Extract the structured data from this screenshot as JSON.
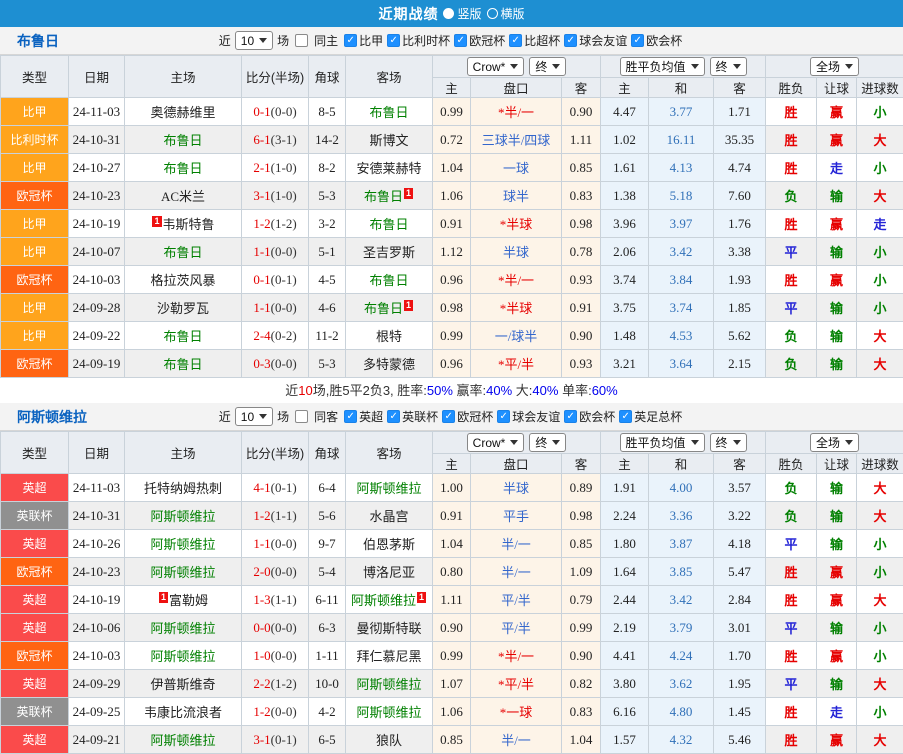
{
  "title_bar": {
    "title": "近期战绩",
    "radios": [
      {
        "label": "竖版",
        "selected": true
      },
      {
        "label": "横版",
        "selected": false
      }
    ]
  },
  "columns": {
    "main": [
      "类型",
      "日期",
      "主场",
      "比分(半场)",
      "角球",
      "客场"
    ],
    "sub": [
      "主",
      "盘口",
      "客",
      "主",
      "和",
      "客",
      "胜负",
      "让球",
      "进球数"
    ],
    "selects": [
      "Crow*",
      "终",
      "胜平负均值",
      "终",
      "全场"
    ]
  },
  "colors": {
    "red": "#e60000",
    "green": "#008000",
    "blue": "#2323d6",
    "summary_blue": "#0000ee",
    "league_orange": "#ffa41c",
    "league_deep_orange": "#ff6412",
    "league_red": "#fa4b4b",
    "league_gray": "#909090"
  },
  "teams": [
    {
      "name": "布鲁日",
      "filter": {
        "near_label": "近",
        "games": "10",
        "games_suffix": "场",
        "same_label": "同主",
        "same_checked": false,
        "leagues": [
          "比甲",
          "比利时杯",
          "欧冠杯",
          "比超杯",
          "球会友谊",
          "欧会杯"
        ]
      },
      "rows": [
        {
          "league": "比甲",
          "league_bg": "#ffa41c",
          "date": "24-11-03",
          "home": "奥德赫维里",
          "home_focus": false,
          "home_badge": "",
          "score": "0-1",
          "half": "(0-0)",
          "corners": "8-5",
          "away": "布鲁日",
          "away_focus": true,
          "away_badge": "",
          "ah_home": "0.99",
          "handicap": "*半/一",
          "handicap_red": true,
          "ah_away": "0.90",
          "eu_home": "4.47",
          "eu_draw": "3.77",
          "eu_away": "1.71",
          "result": "胜",
          "result_c": "r",
          "let": "赢",
          "let_c": "r",
          "goal": "小",
          "goal_c": "g"
        },
        {
          "league": "比利时杯",
          "league_bg": "#ffa41c",
          "date": "24-10-31",
          "home": "布鲁日",
          "home_focus": true,
          "home_badge": "",
          "score": "6-1",
          "half": "(3-1)",
          "corners": "14-2",
          "away": "斯博文",
          "away_focus": false,
          "away_badge": "",
          "ah_home": "0.72",
          "handicap": "三球半/四球",
          "handicap_red": false,
          "ah_away": "1.11",
          "eu_home": "1.02",
          "eu_draw": "16.11",
          "eu_away": "35.35",
          "result": "胜",
          "result_c": "r",
          "let": "赢",
          "let_c": "r",
          "goal": "大",
          "goal_c": "r"
        },
        {
          "league": "比甲",
          "league_bg": "#ffa41c",
          "date": "24-10-27",
          "home": "布鲁日",
          "home_focus": true,
          "home_badge": "",
          "score": "2-1",
          "half": "(1-0)",
          "corners": "8-2",
          "away": "安德莱赫特",
          "away_focus": false,
          "away_badge": "",
          "ah_home": "1.04",
          "handicap": "一球",
          "handicap_red": false,
          "ah_away": "0.85",
          "eu_home": "1.61",
          "eu_draw": "4.13",
          "eu_away": "4.74",
          "result": "胜",
          "result_c": "r",
          "let": "走",
          "let_c": "b",
          "goal": "小",
          "goal_c": "g"
        },
        {
          "league": "欧冠杯",
          "league_bg": "#ff6412",
          "date": "24-10-23",
          "home": "AC米兰",
          "home_focus": false,
          "home_badge": "",
          "score": "3-1",
          "half": "(1-0)",
          "corners": "5-3",
          "away": "布鲁日",
          "away_focus": true,
          "away_badge": "right",
          "ah_home": "1.06",
          "handicap": "球半",
          "handicap_red": false,
          "ah_away": "0.83",
          "eu_home": "1.38",
          "eu_draw": "5.18",
          "eu_away": "7.60",
          "result": "负",
          "result_c": "g",
          "let": "输",
          "let_c": "g",
          "goal": "大",
          "goal_c": "r"
        },
        {
          "league": "比甲",
          "league_bg": "#ffa41c",
          "date": "24-10-19",
          "home": "韦斯特鲁",
          "home_focus": false,
          "home_badge": "left",
          "score": "1-2",
          "half": "(1-2)",
          "corners": "3-2",
          "away": "布鲁日",
          "away_focus": true,
          "away_badge": "",
          "ah_home": "0.91",
          "handicap": "*半球",
          "handicap_red": true,
          "ah_away": "0.98",
          "eu_home": "3.96",
          "eu_draw": "3.97",
          "eu_away": "1.76",
          "result": "胜",
          "result_c": "r",
          "let": "赢",
          "let_c": "r",
          "goal": "走",
          "goal_c": "b"
        },
        {
          "league": "比甲",
          "league_bg": "#ffa41c",
          "date": "24-10-07",
          "home": "布鲁日",
          "home_focus": true,
          "home_badge": "",
          "score": "1-1",
          "half": "(0-0)",
          "corners": "5-1",
          "away": "圣吉罗斯",
          "away_focus": false,
          "away_badge": "",
          "ah_home": "1.12",
          "handicap": "半球",
          "handicap_red": false,
          "ah_away": "0.78",
          "eu_home": "2.06",
          "eu_draw": "3.42",
          "eu_away": "3.38",
          "result": "平",
          "result_c": "b",
          "let": "输",
          "let_c": "g",
          "goal": "小",
          "goal_c": "g"
        },
        {
          "league": "欧冠杯",
          "league_bg": "#ff6412",
          "date": "24-10-03",
          "home": "格拉茨风暴",
          "home_focus": false,
          "home_badge": "",
          "score": "0-1",
          "half": "(0-1)",
          "corners": "4-5",
          "away": "布鲁日",
          "away_focus": true,
          "away_badge": "",
          "ah_home": "0.96",
          "handicap": "*半/一",
          "handicap_red": true,
          "ah_away": "0.93",
          "eu_home": "3.74",
          "eu_draw": "3.84",
          "eu_away": "1.93",
          "result": "胜",
          "result_c": "r",
          "let": "赢",
          "let_c": "r",
          "goal": "小",
          "goal_c": "g"
        },
        {
          "league": "比甲",
          "league_bg": "#ffa41c",
          "date": "24-09-28",
          "home": "沙勒罗瓦",
          "home_focus": false,
          "home_badge": "",
          "score": "1-1",
          "half": "(0-0)",
          "corners": "4-6",
          "away": "布鲁日",
          "away_focus": true,
          "away_badge": "right",
          "ah_home": "0.98",
          "handicap": "*半球",
          "handicap_red": true,
          "ah_away": "0.91",
          "eu_home": "3.75",
          "eu_draw": "3.74",
          "eu_away": "1.85",
          "result": "平",
          "result_c": "b",
          "let": "输",
          "let_c": "g",
          "goal": "小",
          "goal_c": "g"
        },
        {
          "league": "比甲",
          "league_bg": "#ffa41c",
          "date": "24-09-22",
          "home": "布鲁日",
          "home_focus": true,
          "home_badge": "",
          "score": "2-4",
          "half": "(0-2)",
          "corners": "11-2",
          "away": "根特",
          "away_focus": false,
          "away_badge": "",
          "ah_home": "0.99",
          "handicap": "一/球半",
          "handicap_red": false,
          "ah_away": "0.90",
          "eu_home": "1.48",
          "eu_draw": "4.53",
          "eu_away": "5.62",
          "result": "负",
          "result_c": "g",
          "let": "输",
          "let_c": "g",
          "goal": "大",
          "goal_c": "r"
        },
        {
          "league": "欧冠杯",
          "league_bg": "#ff6412",
          "date": "24-09-19",
          "home": "布鲁日",
          "home_focus": true,
          "home_badge": "",
          "score": "0-3",
          "half": "(0-0)",
          "corners": "5-3",
          "away": "多特蒙德",
          "away_focus": false,
          "away_badge": "",
          "ah_home": "0.96",
          "handicap": "*平/半",
          "handicap_red": true,
          "ah_away": "0.93",
          "eu_home": "3.21",
          "eu_draw": "3.64",
          "eu_away": "2.15",
          "result": "负",
          "result_c": "g",
          "let": "输",
          "let_c": "g",
          "goal": "大",
          "goal_c": "r"
        }
      ],
      "summary": [
        {
          "t": "近",
          "c": "d"
        },
        {
          "t": "10",
          "c": "r"
        },
        {
          "t": "场,胜5平2负3, 胜率:",
          "c": "d"
        },
        {
          "t": "50%",
          "c": "u"
        },
        {
          "t": " 赢率:",
          "c": "d"
        },
        {
          "t": "40%",
          "c": "u"
        },
        {
          "t": " 大:",
          "c": "d"
        },
        {
          "t": "40%",
          "c": "u"
        },
        {
          "t": " 单率:",
          "c": "d"
        },
        {
          "t": "60%",
          "c": "u"
        }
      ]
    },
    {
      "name": "阿斯顿维拉",
      "filter": {
        "near_label": "近",
        "games": "10",
        "games_suffix": "场",
        "same_label": "同客",
        "same_checked": false,
        "leagues": [
          "英超",
          "英联杯",
          "欧冠杯",
          "球会友谊",
          "欧会杯",
          "英足总杯"
        ]
      },
      "rows": [
        {
          "league": "英超",
          "league_bg": "#fa4b4b",
          "date": "24-11-03",
          "home": "托特纳姆热刺",
          "home_focus": false,
          "home_badge": "",
          "score": "4-1",
          "half": "(0-1)",
          "corners": "6-4",
          "away": "阿斯顿维拉",
          "away_focus": true,
          "away_badge": "",
          "ah_home": "1.00",
          "handicap": "半球",
          "handicap_red": false,
          "ah_away": "0.89",
          "eu_home": "1.91",
          "eu_draw": "4.00",
          "eu_away": "3.57",
          "result": "负",
          "result_c": "g",
          "let": "输",
          "let_c": "g",
          "goal": "大",
          "goal_c": "r"
        },
        {
          "league": "英联杯",
          "league_bg": "#909090",
          "date": "24-10-31",
          "home": "阿斯顿维拉",
          "home_focus": true,
          "home_badge": "",
          "score": "1-2",
          "half": "(1-1)",
          "corners": "5-6",
          "away": "水晶宫",
          "away_focus": false,
          "away_badge": "",
          "ah_home": "0.91",
          "handicap": "平手",
          "handicap_red": false,
          "ah_away": "0.98",
          "eu_home": "2.24",
          "eu_draw": "3.36",
          "eu_away": "3.22",
          "result": "负",
          "result_c": "g",
          "let": "输",
          "let_c": "g",
          "goal": "大",
          "goal_c": "r"
        },
        {
          "league": "英超",
          "league_bg": "#fa4b4b",
          "date": "24-10-26",
          "home": "阿斯顿维拉",
          "home_focus": true,
          "home_badge": "",
          "score": "1-1",
          "half": "(0-0)",
          "corners": "9-7",
          "away": "伯恩茅斯",
          "away_focus": false,
          "away_badge": "",
          "ah_home": "1.04",
          "handicap": "半/一",
          "handicap_red": false,
          "ah_away": "0.85",
          "eu_home": "1.80",
          "eu_draw": "3.87",
          "eu_away": "4.18",
          "result": "平",
          "result_c": "b",
          "let": "输",
          "let_c": "g",
          "goal": "小",
          "goal_c": "g"
        },
        {
          "league": "欧冠杯",
          "league_bg": "#ff6412",
          "date": "24-10-23",
          "home": "阿斯顿维拉",
          "home_focus": true,
          "home_badge": "",
          "score": "2-0",
          "half": "(0-0)",
          "corners": "5-4",
          "away": "博洛尼亚",
          "away_focus": false,
          "away_badge": "",
          "ah_home": "0.80",
          "handicap": "半/一",
          "handicap_red": false,
          "ah_away": "1.09",
          "eu_home": "1.64",
          "eu_draw": "3.85",
          "eu_away": "5.47",
          "result": "胜",
          "result_c": "r",
          "let": "赢",
          "let_c": "r",
          "goal": "小",
          "goal_c": "g"
        },
        {
          "league": "英超",
          "league_bg": "#fa4b4b",
          "date": "24-10-19",
          "home": "富勒姆",
          "home_focus": false,
          "home_badge": "left",
          "score": "1-3",
          "half": "(1-1)",
          "corners": "6-11",
          "away": "阿斯顿维拉",
          "away_focus": true,
          "away_badge": "right",
          "ah_home": "1.11",
          "handicap": "平/半",
          "handicap_red": false,
          "ah_away": "0.79",
          "eu_home": "2.44",
          "eu_draw": "3.42",
          "eu_away": "2.84",
          "result": "胜",
          "result_c": "r",
          "let": "赢",
          "let_c": "r",
          "goal": "大",
          "goal_c": "r"
        },
        {
          "league": "英超",
          "league_bg": "#fa4b4b",
          "date": "24-10-06",
          "home": "阿斯顿维拉",
          "home_focus": true,
          "home_badge": "",
          "score": "0-0",
          "half": "(0-0)",
          "corners": "6-3",
          "away": "曼彻斯特联",
          "away_focus": false,
          "away_badge": "",
          "ah_home": "0.90",
          "handicap": "平/半",
          "handicap_red": false,
          "ah_away": "0.99",
          "eu_home": "2.19",
          "eu_draw": "3.79",
          "eu_away": "3.01",
          "result": "平",
          "result_c": "b",
          "let": "输",
          "let_c": "g",
          "goal": "小",
          "goal_c": "g"
        },
        {
          "league": "欧冠杯",
          "league_bg": "#ff6412",
          "date": "24-10-03",
          "home": "阿斯顿维拉",
          "home_focus": true,
          "home_badge": "",
          "score": "1-0",
          "half": "(0-0)",
          "corners": "1-11",
          "away": "拜仁慕尼黑",
          "away_focus": false,
          "away_badge": "",
          "ah_home": "0.99",
          "handicap": "*半/一",
          "handicap_red": true,
          "ah_away": "0.90",
          "eu_home": "4.41",
          "eu_draw": "4.24",
          "eu_away": "1.70",
          "result": "胜",
          "result_c": "r",
          "let": "赢",
          "let_c": "r",
          "goal": "小",
          "goal_c": "g"
        },
        {
          "league": "英超",
          "league_bg": "#fa4b4b",
          "date": "24-09-29",
          "home": "伊普斯维奇",
          "home_focus": false,
          "home_badge": "",
          "score": "2-2",
          "half": "(1-2)",
          "corners": "10-0",
          "away": "阿斯顿维拉",
          "away_focus": true,
          "away_badge": "",
          "ah_home": "1.07",
          "handicap": "*平/半",
          "handicap_red": true,
          "ah_away": "0.82",
          "eu_home": "3.80",
          "eu_draw": "3.62",
          "eu_away": "1.95",
          "result": "平",
          "result_c": "b",
          "let": "输",
          "let_c": "g",
          "goal": "大",
          "goal_c": "r"
        },
        {
          "league": "英联杯",
          "league_bg": "#909090",
          "date": "24-09-25",
          "home": "韦康比流浪者",
          "home_focus": false,
          "home_badge": "",
          "score": "1-2",
          "half": "(0-0)",
          "corners": "4-2",
          "away": "阿斯顿维拉",
          "away_focus": true,
          "away_badge": "",
          "ah_home": "1.06",
          "handicap": "*一球",
          "handicap_red": true,
          "ah_away": "0.83",
          "eu_home": "6.16",
          "eu_draw": "4.80",
          "eu_away": "1.45",
          "result": "胜",
          "result_c": "r",
          "let": "走",
          "let_c": "b",
          "goal": "小",
          "goal_c": "g"
        },
        {
          "league": "英超",
          "league_bg": "#fa4b4b",
          "date": "24-09-21",
          "home": "阿斯顿维拉",
          "home_focus": true,
          "home_badge": "",
          "score": "3-1",
          "half": "(0-1)",
          "corners": "6-5",
          "away": "狼队",
          "away_focus": false,
          "away_badge": "",
          "ah_home": "0.85",
          "handicap": "半/一",
          "handicap_red": false,
          "ah_away": "1.04",
          "eu_home": "1.57",
          "eu_draw": "4.32",
          "eu_away": "5.46",
          "result": "胜",
          "result_c": "r",
          "let": "赢",
          "let_c": "r",
          "goal": "大",
          "goal_c": "r"
        }
      ],
      "summary": []
    }
  ]
}
